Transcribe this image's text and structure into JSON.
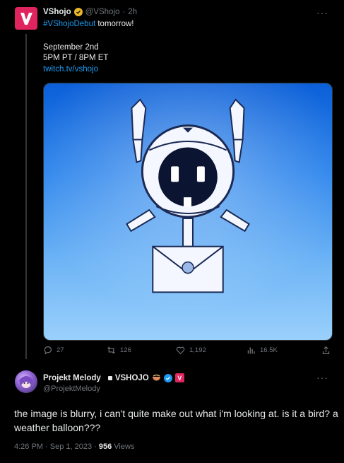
{
  "tweet": {
    "name": "VShojo",
    "handle": "@VShojo",
    "time_sep": "·",
    "time": "2h",
    "more": "···",
    "hashtag": "#VShojoDebut",
    "line1_rest": " tomorrow!",
    "date": "September 2nd",
    "times": "5PM PT / 8PM ET",
    "url": "twitch.tv/vshojo",
    "stats": {
      "replies": "27",
      "retweets": "126",
      "likes": "1,192",
      "views": "16.5K"
    }
  },
  "reply": {
    "name": "Projekt Melody",
    "affiliation": "VSHOJO",
    "affiliation_badge": "V",
    "handle": "@ProjektMelody",
    "more": "···",
    "text": "the image is blurry, i can't quite make out what i'm looking at. is it a bird? a weather balloon???",
    "time": "4:26 PM",
    "dot1": " · ",
    "date": "Sep 1, 2023",
    "dot2": " · ",
    "views_count": "956",
    "views_label": " Views"
  },
  "colors": {
    "accent": "#1d9bf0",
    "brand": "#e0245e",
    "verified_gold": "#e8b829",
    "background": "#000000"
  }
}
